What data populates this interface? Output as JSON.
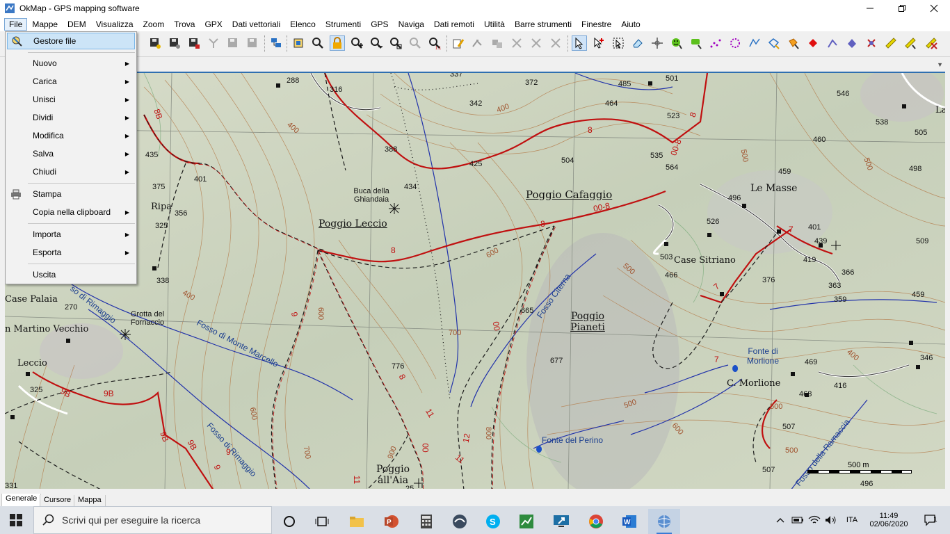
{
  "window": {
    "title": "OkMap - GPS mapping software",
    "controls": [
      "minimize",
      "maximize",
      "close"
    ]
  },
  "menubar": {
    "items": [
      "File",
      "Mappe",
      "DEM",
      "Visualizza",
      "Zoom",
      "Trova",
      "GPX",
      "Dati vettoriali",
      "Elenco",
      "Strumenti",
      "GPS",
      "Naviga",
      "Dati remoti",
      "Utilità",
      "Barre strumenti",
      "Finestre",
      "Aiuto"
    ],
    "open_item": "File"
  },
  "file_menu": {
    "items": [
      {
        "label": "Gestore file",
        "highlighted": true,
        "submenu": false,
        "icon": "file-manager-icon"
      },
      {
        "label": "Nuovo",
        "submenu": true
      },
      {
        "label": "Carica",
        "submenu": true
      },
      {
        "label": "Unisci",
        "submenu": true
      },
      {
        "label": "Dividi",
        "submenu": true
      },
      {
        "label": "Modifica",
        "submenu": true
      },
      {
        "label": "Salva",
        "submenu": true
      },
      {
        "label": "Chiudi",
        "submenu": true
      },
      {
        "label": "Stampa",
        "submenu": false,
        "icon": "printer-icon"
      },
      {
        "label": "Copia nella clipboard",
        "submenu": true
      },
      {
        "label": "Importa",
        "submenu": true
      },
      {
        "label": "Esporta",
        "submenu": true
      },
      {
        "label": "Uscita",
        "submenu": false
      }
    ]
  },
  "map": {
    "places": [
      "Poggio Leccio",
      "Poggio Cafaggio",
      "Poggio Pianeti",
      "Poggio all'Aia",
      "Le Masse",
      "Case Sitriano",
      "C. Morlione",
      "Case Palaia",
      "Ripa",
      "Leccio",
      "n Martino Vecchio",
      "Buca della Ghiandaia",
      "Grotta del Fornaccio",
      "La"
    ],
    "water_labels": [
      "Fosso di Monte Marcello",
      "Fosso di Rimaggio",
      "Fosso Citerna",
      "Fosso della Ramaccia",
      "Fonte di Morlione",
      "Fonte del Perino",
      "so di Rimaggio"
    ],
    "elevations": [
      "288",
      "316",
      "337",
      "372",
      "342",
      "485",
      "501",
      "464",
      "523",
      "546",
      "538",
      "505",
      "435",
      "388",
      "425",
      "504",
      "535",
      "564",
      "460",
      "498",
      "375",
      "401",
      "434",
      "496",
      "459",
      "356",
      "325",
      "526",
      "401",
      "439",
      "509",
      "338",
      "503",
      "466",
      "419",
      "366",
      "376",
      "363",
      "359",
      "459",
      "270",
      "665",
      "677",
      "469",
      "346",
      "776",
      "416",
      "325",
      "468",
      "507",
      "507",
      "496",
      "331",
      "25"
    ],
    "contour_labels": [
      "400",
      "400",
      "500",
      "500",
      "600",
      "700",
      "600",
      "500",
      "400",
      "500",
      "600",
      "700",
      "800",
      "900",
      "500",
      "400",
      "600",
      "500"
    ],
    "trail_numbers": [
      "8B",
      "8",
      "8",
      "00-8",
      "00-8",
      "8",
      "8",
      "9",
      "9B",
      "9B",
      "9B",
      "9B",
      "9",
      "9",
      "11",
      "11",
      "12",
      "11",
      "00",
      "7",
      "7",
      "7",
      "8",
      "00"
    ],
    "scale": "500 m"
  },
  "bottom_tabs": {
    "items": [
      "Generale",
      "Cursore",
      "Mappa"
    ],
    "selected": "Generale"
  },
  "taskbar": {
    "search_placeholder": "Scrivi qui per eseguire la ricerca",
    "language": "ITA",
    "time": "11:49",
    "date": "02/06/2020",
    "notifications": "1"
  }
}
